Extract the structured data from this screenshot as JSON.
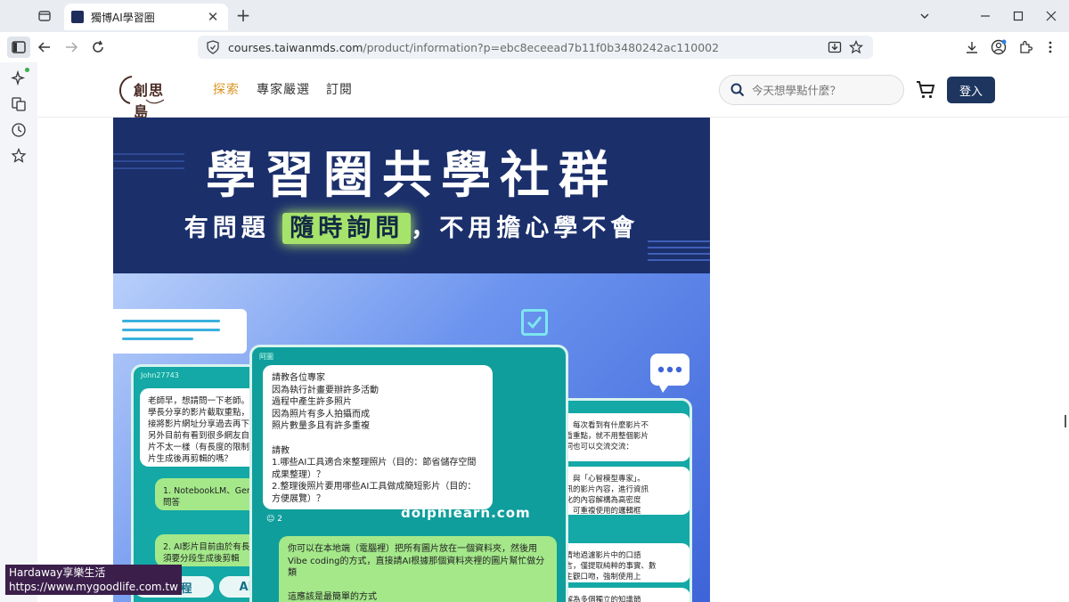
{
  "browser": {
    "tab_title": "獨博AI學習圈",
    "url_host": "courses.taiwanmds.com",
    "url_path": "/product/information?p=ebc8eceead7b11f0b3480242ac110002"
  },
  "site": {
    "logo_text": "創思島",
    "nav": [
      {
        "label": "探索",
        "active": true
      },
      {
        "label": "專家嚴選",
        "active": false
      },
      {
        "label": "訂閱",
        "active": false
      }
    ],
    "search_placeholder": "今天想學點什麼？",
    "login_label": "登入",
    "accent_color": "#d9931f",
    "brand_color": "#1d355f"
  },
  "banner": {
    "title": "學習圈共學社群",
    "subtitle_pre": "有問題",
    "subtitle_highlight": "隨時詢問",
    "subtitle_post": "，不用擔心學不會",
    "domain_watermark": "dolphlearn.com",
    "left_card": {
      "header": "John27743",
      "question": "老師早，想請問一下老師。\n學長分享的影片截取重點，需\n接將影片網址分享過去再下指\n另外目前有看到很多網友自動\n片不太一樣（有長度的限制）\n片生成後再剪輯的嗎？",
      "answer1": "1. NotebookLM、Gemini\n問答",
      "answer2": "2. AI影片目前由於有長度\n須要分段生成後剪輯",
      "pill1": "AI課程",
      "pill2": "AI"
    },
    "center_card": {
      "header": "阿圖",
      "question": "請教各位專家\n因為執行計畫要辦許多活動\n過程中產生許多照片\n因為照片有多人拍攝而成\n照片數量多且有許多重複\n\n請教\n1.哪些AI工具適合來整理照片（目的：節省儲存空間 成果整理）？\n2.整理後照片要用哪些AI工具做成簡短影片（目的：方便展覽）？",
      "reaction_count": "2",
      "answer": "你可以在本地端（電腦裡）把所有圖片放在一個資料夾，然後用Vibe coding的方式，直接請AI根據那個資料夾裡的圖片幫忙做分類\n\n這應該是最簡單的方式"
    },
    "right_card": {
      "text1": "提示詞，每次看到有什麼影片不\n示詞去看重點，就不用整個影片\n的提示詞也可以交流交流：",
      "text2": "架構師」與「心智模型專家」。\n取高雜訊的影片內容，進行資訊\n、口語化的內容解構為高密度\n、可記、可重複使用的邏輯框",
      "text3": "**：無情地過濾影片中的口語\n客套發言，僅提取純粹的事實、數\n講者的主觀口吻，強制使用上",
      "text4": "影片拆解為多個獨立的知識節"
    }
  },
  "overlay": {
    "line1": "Hardaway享樂生活",
    "line2": "https://www.mygoodlife.com.tw"
  }
}
